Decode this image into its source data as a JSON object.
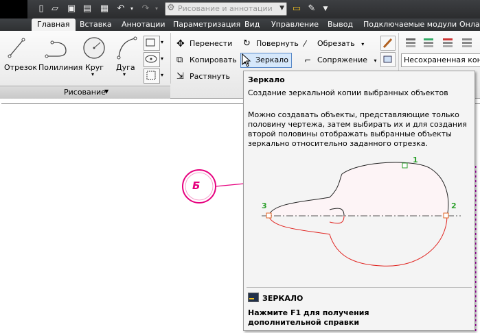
{
  "quick_access": {
    "workspace": "Рисование и аннотации"
  },
  "tabs": [
    {
      "label": "Главная",
      "active": true
    },
    {
      "label": "Вставка"
    },
    {
      "label": "Аннотации"
    },
    {
      "label": "Параметризация"
    },
    {
      "label": "Вид"
    },
    {
      "label": "Управление"
    },
    {
      "label": "Вывод"
    },
    {
      "label": "Подключаемые модули"
    },
    {
      "label": "Онлай"
    }
  ],
  "draw_panel": {
    "title": "Рисование",
    "tools": [
      "Отрезок",
      "Полилиния",
      "Круг",
      "Дуга"
    ]
  },
  "modify_panel": {
    "move": "Перенести",
    "copy": "Копировать",
    "stretch": "Растянуть",
    "rotate": "Повернуть",
    "mirror": "Зеркало",
    "trim": "Обрезать",
    "fillet": "Сопряжение"
  },
  "layers": {
    "layer_state": "Несохраненная конфи"
  },
  "canvas": {
    "callout": "Б"
  },
  "tooltip": {
    "title": "Зеркало",
    "subtitle": "Создание зеркальной копии выбранных объектов",
    "description": "Можно создавать объекты, представляющие только половину чертежа, затем выбирать их и для создания второй половины отображать выбранные объекты зеркально относительно заданного отрезка.",
    "points": [
      "1",
      "2",
      "3"
    ],
    "command": "ЗЕРКАЛО",
    "help": "Нажмите F1 для получения дополнительной справки"
  },
  "colors": {
    "accent_callout": "#e6007e",
    "mirror_curve": "#e0201c",
    "point_label": "#2ca02c"
  }
}
